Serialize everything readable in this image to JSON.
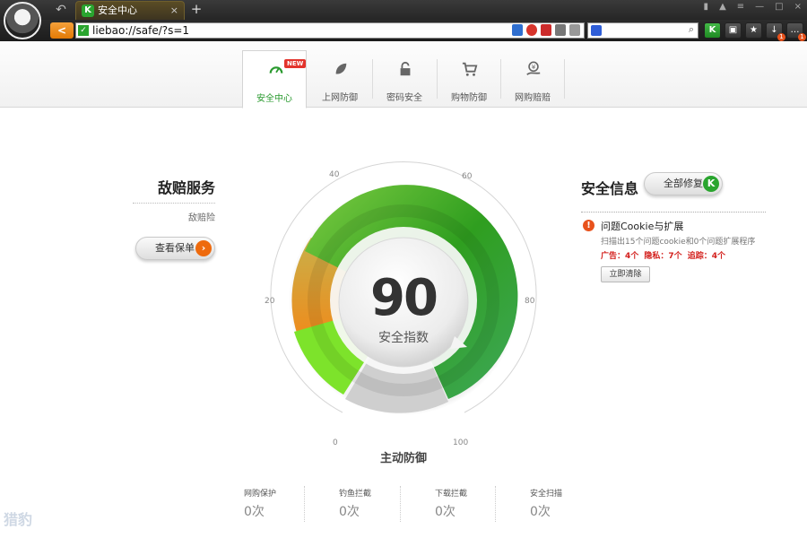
{
  "browser": {
    "tab_title": "安全中心",
    "tab_close": "×",
    "new_tab": "+",
    "address": "liebao://safe/?s=1",
    "minimize": "—",
    "maximize": "□",
    "close": "×",
    "back": "<"
  },
  "nav": {
    "tabs": [
      {
        "label": "安全中心",
        "badge": "NEW"
      },
      {
        "label": "上网防御"
      },
      {
        "label": "密码安全"
      },
      {
        "label": "购物防御"
      },
      {
        "label": "网购赔赔"
      }
    ]
  },
  "left": {
    "title": "敌赔服务",
    "subtitle": "敌赔险",
    "button": "查看保单"
  },
  "right": {
    "title": "安全信息",
    "fix_all": "全部修复",
    "issue_title": "问题Cookie与扩展",
    "issue_desc": "扫描出15个问题cookie和0个问题扩展程序",
    "issue_stats": "广告：4个  隐私：7个  追踪：4个",
    "clear_button": "立即清除"
  },
  "gauge": {
    "score": "90",
    "score_label": "安全指数",
    "caption": "主动防御",
    "ticks": [
      "0",
      "20",
      "40",
      "60",
      "80",
      "100"
    ]
  },
  "stats": [
    {
      "label": "网购保护",
      "value": "0次"
    },
    {
      "label": "钓鱼拦截",
      "value": "0次"
    },
    {
      "label": "下载拦截",
      "value": "0次"
    },
    {
      "label": "安全扫描",
      "value": "0次"
    }
  ],
  "watermark": "猎豹"
}
